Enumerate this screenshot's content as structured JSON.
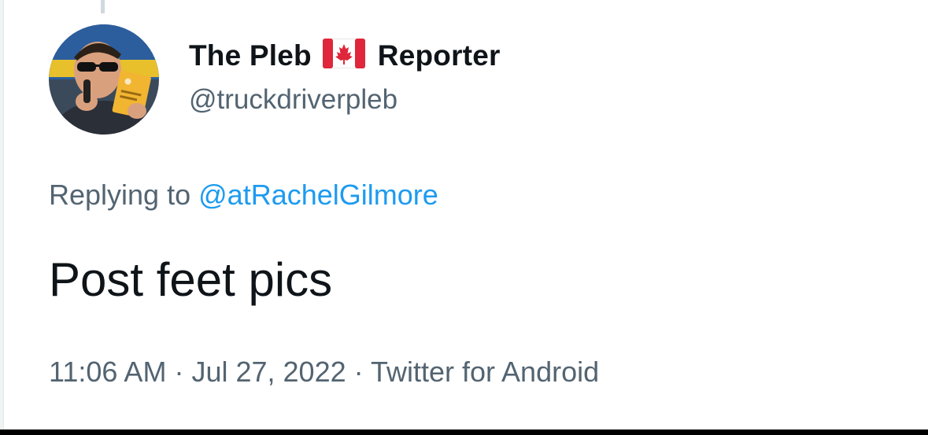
{
  "tweet": {
    "author": {
      "name_part1": "The Pleb",
      "flag_icon": "canada-flag-icon",
      "name_part2": "Reporter",
      "handle": "@truckdriverpleb"
    },
    "reply": {
      "prefix": "Replying to",
      "mention": "@atRachelGilmore"
    },
    "text": "Post feet pics",
    "meta": {
      "time": "11:06 AM",
      "separator": "·",
      "date": "Jul 27, 2022",
      "source": "Twitter for Android"
    }
  },
  "colors": {
    "text_primary": "#0f1419",
    "text_secondary": "#536471",
    "link": "#1d9bf0",
    "flag_red": "#e0263a"
  }
}
